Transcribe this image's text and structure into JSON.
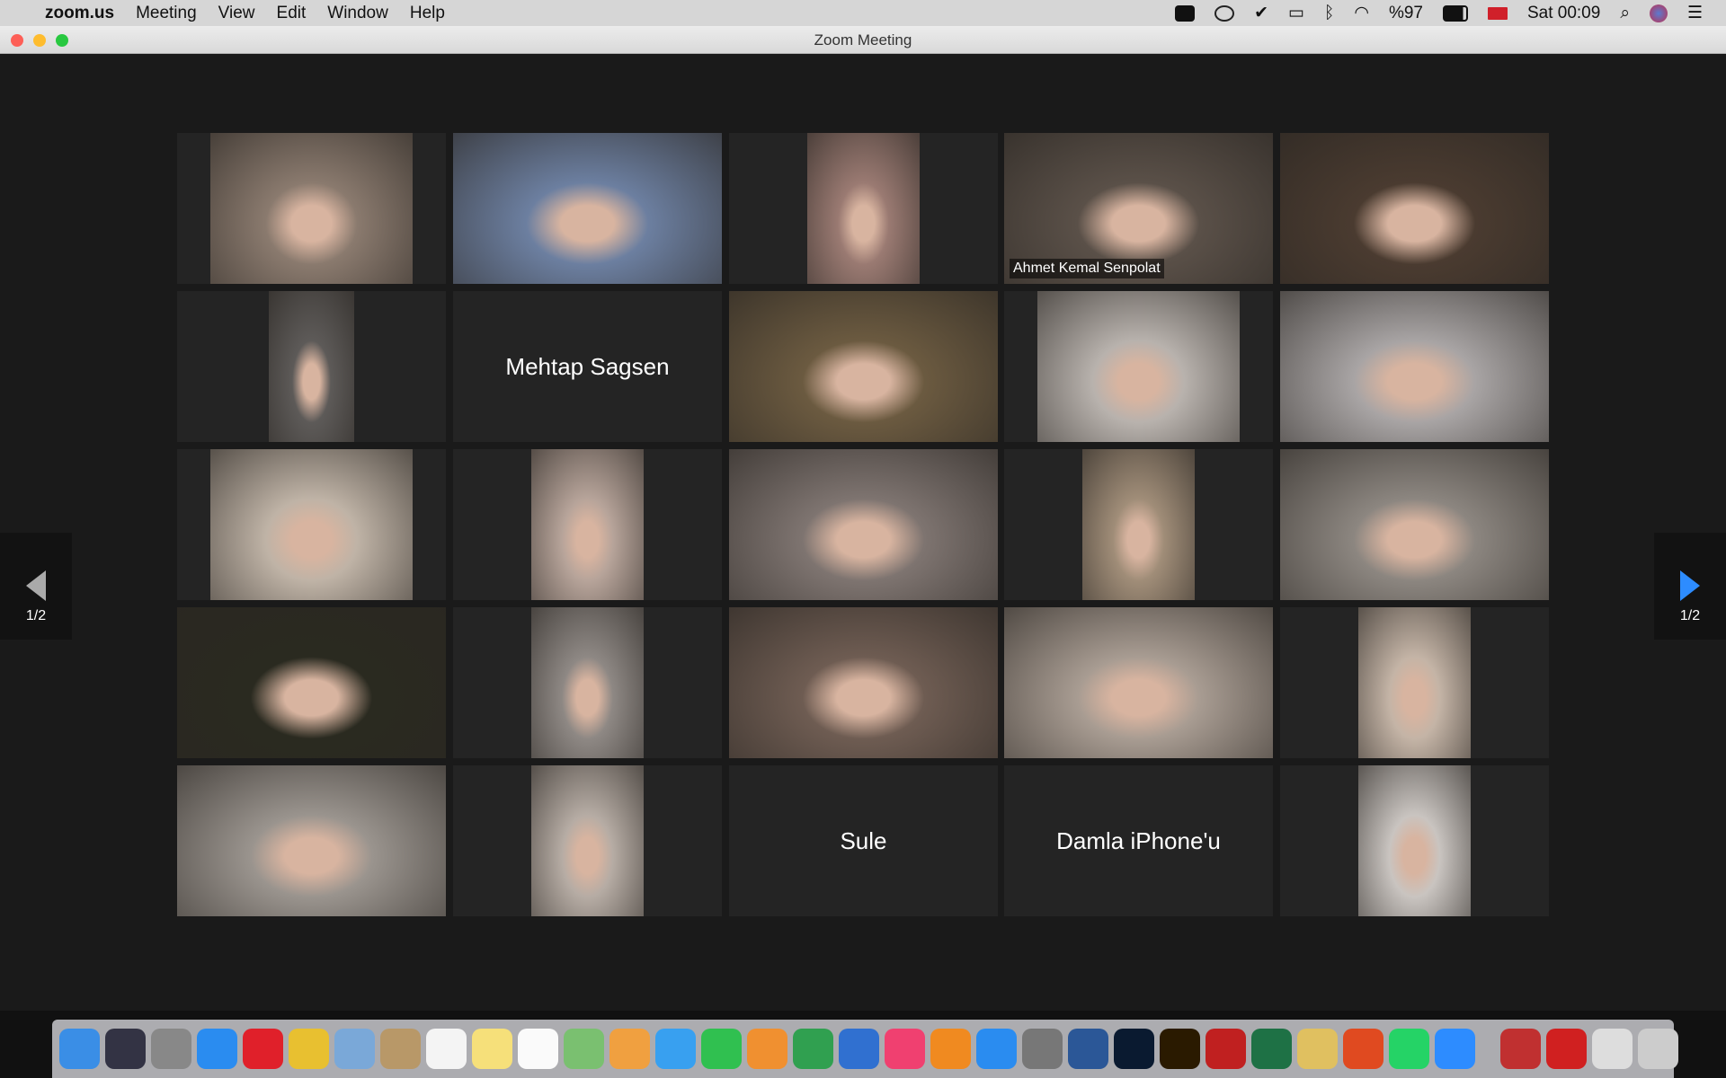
{
  "menubar": {
    "app": "zoom.us",
    "items": [
      "Meeting",
      "View",
      "Edit",
      "Window",
      "Help"
    ],
    "battery": "%97",
    "clock": "Sat 00:09"
  },
  "window": {
    "title": "Zoom Meeting"
  },
  "tiles": [
    {
      "type": "video",
      "color": "#8a7a6e"
    },
    {
      "type": "video",
      "color": "#6c7fa0"
    },
    {
      "type": "video",
      "color": "#9a7a72"
    },
    {
      "type": "video",
      "color": "#5a5048",
      "name": "Ahmet Kemal Senpolat",
      "active": true
    },
    {
      "type": "video",
      "color": "#4a3b30"
    },
    {
      "type": "video",
      "color": "#5d5a58"
    },
    {
      "type": "name",
      "name": "Mehtap Sagsen"
    },
    {
      "type": "video",
      "color": "#6b5a40"
    },
    {
      "type": "video",
      "color": "#b8b2ad"
    },
    {
      "type": "video",
      "color": "#a8a4a4"
    },
    {
      "type": "video",
      "color": "#bfb3a6"
    },
    {
      "type": "video",
      "color": "#b7a49a"
    },
    {
      "type": "video",
      "color": "#7e7470"
    },
    {
      "type": "video",
      "color": "#a08d78"
    },
    {
      "type": "video",
      "color": "#8c8680"
    },
    {
      "type": "video",
      "color": "#2a2a20"
    },
    {
      "type": "video",
      "color": "#8e8884"
    },
    {
      "type": "video",
      "color": "#6e5c52"
    },
    {
      "type": "video",
      "color": "#a89c92"
    },
    {
      "type": "video",
      "color": "#c4b4a6"
    },
    {
      "type": "video",
      "color": "#9a948e"
    },
    {
      "type": "video",
      "color": "#b6aca4"
    },
    {
      "type": "name",
      "name": "Sule"
    },
    {
      "type": "name",
      "name": "Damla iPhone'u"
    },
    {
      "type": "video",
      "color": "#c9c4c0"
    }
  ],
  "pager": {
    "left": "1/2",
    "right": "1/2"
  },
  "dock": [
    "finder",
    "siri",
    "launchpad",
    "safari",
    "opera",
    "chrome",
    "mail",
    "contacts",
    "calendar",
    "notes",
    "reminders",
    "maps",
    "photos",
    "messages",
    "facetime",
    "pages",
    "numbers",
    "keynote",
    "itunes",
    "books",
    "app-store",
    "system-preferences",
    "word",
    "photoshop",
    "illustrator",
    "acrobat",
    "excel",
    "scissors",
    "office",
    "whatsapp",
    "zoom",
    "separator",
    "pdf-doc",
    "acrobat-reader",
    "preview",
    "trash"
  ]
}
